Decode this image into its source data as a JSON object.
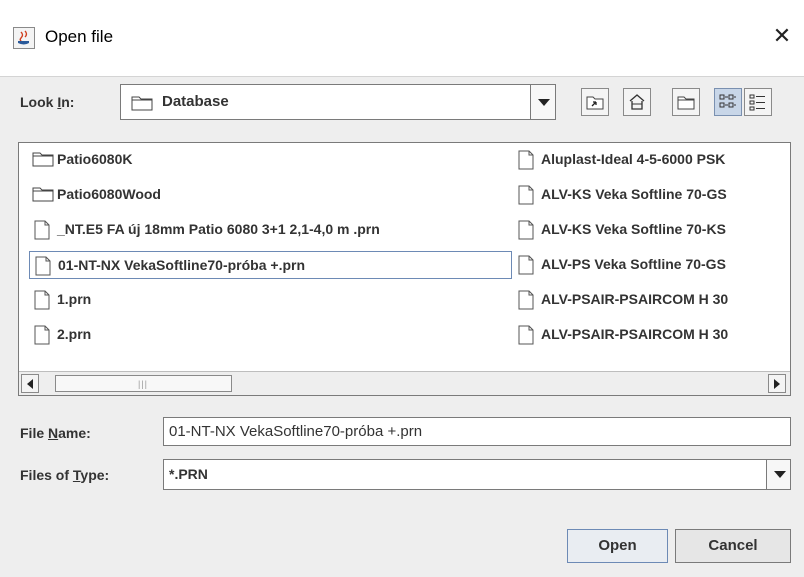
{
  "dialog": {
    "title": "Open file",
    "close_glyph": "✕"
  },
  "look_in": {
    "label_pre": "Look ",
    "label_mnemonic": "I",
    "label_post": "n:",
    "value": "Database",
    "icon": "folder-icon"
  },
  "toolbar": {
    "buttons": [
      {
        "name": "up-one-level-button",
        "icon": "up-folder-icon"
      },
      {
        "name": "home-button",
        "icon": "home-icon"
      },
      {
        "name": "new-folder-button",
        "icon": "new-folder-icon"
      },
      {
        "name": "list-view-button",
        "icon": "list-view-icon",
        "pressed": true
      },
      {
        "name": "details-view-button",
        "icon": "details-view-icon"
      }
    ]
  },
  "files": {
    "left_column": [
      {
        "name": "Patio6080K",
        "type": "folder"
      },
      {
        "name": "Patio6080Wood",
        "type": "folder"
      },
      {
        "name": "_NT.E5 FA új 18mm Patio 6080 3+1 2,1-4,0 m  .prn",
        "type": "file"
      },
      {
        "name": "01-NT-NX VekaSoftline70-próba +.prn",
        "type": "file",
        "selected": true
      },
      {
        "name": "1.prn",
        "type": "file"
      },
      {
        "name": "2.prn",
        "type": "file"
      }
    ],
    "right_column": [
      {
        "name": "Aluplast-Ideal 4-5-6000 PSK",
        "type": "file"
      },
      {
        "name": "ALV-KS Veka Softline 70-GS",
        "type": "file"
      },
      {
        "name": "ALV-KS Veka Softline 70-KS",
        "type": "file"
      },
      {
        "name": "ALV-PS Veka Softline 70-GS",
        "type": "file"
      },
      {
        "name": "ALV-PSAIR-PSAIRCOM H 30",
        "type": "file"
      },
      {
        "name": "ALV-PSAIR-PSAIRCOM H 30",
        "type": "file"
      }
    ]
  },
  "file_name": {
    "label_pre": "File ",
    "label_mnemonic": "N",
    "label_post": "ame:",
    "value": "01-NT-NX VekaSoftline70-próba +.prn"
  },
  "files_of_type": {
    "label_pre": "Files of ",
    "label_mnemonic": "T",
    "label_post": "ype:",
    "value": "*.PRN"
  },
  "actions": {
    "open_label": "Open",
    "cancel_label": "Cancel"
  },
  "colors": {
    "selection_border": "#6d8ab5",
    "panel_bg": "#eeeeee"
  }
}
